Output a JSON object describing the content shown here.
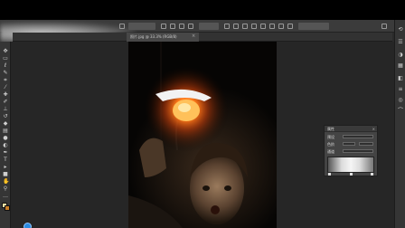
{
  "document": {
    "tab_label": "照片.jpg @ 33.3% (RGB/8)",
    "tab_close": "×"
  },
  "panel": {
    "title": "属性",
    "close": "×",
    "row1_label": "预设",
    "row2_label": "色阶",
    "row3_label": "通道"
  },
  "colors": {
    "foreground": "#f5e2a5",
    "background": "#c87d25",
    "bulb_glow": "#ff6a00"
  },
  "icons": {
    "tools": [
      "move-icon",
      "marquee-icon",
      "lasso-icon",
      "quick-select-icon",
      "crop-icon",
      "eyedropper-icon",
      "heal-icon",
      "brush-icon",
      "stamp-icon",
      "history-brush-icon",
      "eraser-icon",
      "gradient-icon",
      "blur-icon",
      "dodge-icon",
      "pen-icon",
      "type-icon",
      "path-select-icon",
      "shape-icon",
      "hand-icon",
      "zoom-icon",
      "more-icon"
    ],
    "right_panels": [
      "history-icon",
      "properties-icon",
      "color-icon",
      "swatches-icon",
      "adjustments-icon",
      "layers-icon",
      "channels-icon",
      "paths-icon"
    ]
  }
}
